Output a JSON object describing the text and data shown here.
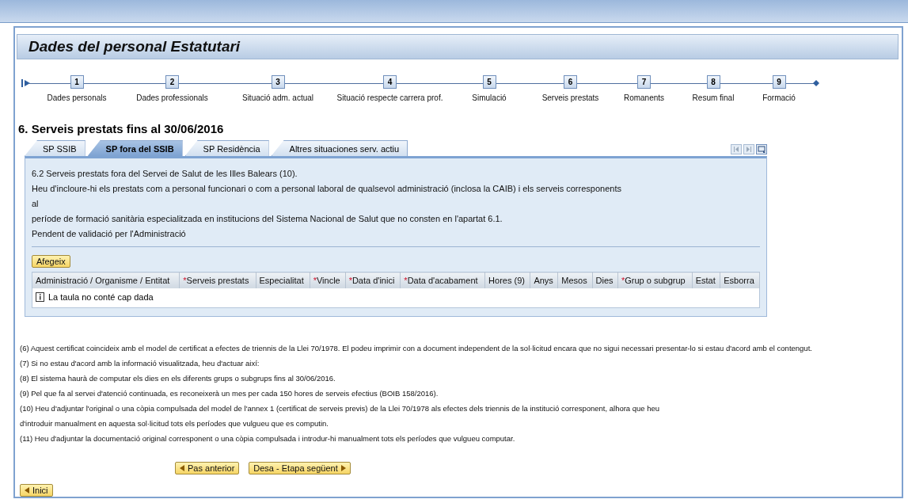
{
  "page_title": "Dades del personal Estatutari",
  "steps": [
    {
      "number": "1",
      "label": "Dades personals"
    },
    {
      "number": "2",
      "label": "Dades professionals"
    },
    {
      "number": "3",
      "label": "Situació adm. actual"
    },
    {
      "number": "4",
      "label": "Situació respecte carrera prof."
    },
    {
      "number": "5",
      "label": "Simulació"
    },
    {
      "number": "6",
      "label": "Serveis prestats"
    },
    {
      "number": "7",
      "label": "Romanents"
    },
    {
      "number": "8",
      "label": "Resum final"
    },
    {
      "number": "9",
      "label": "Formació"
    }
  ],
  "section_title": "6. Serveis prestats fins al 30/06/2016",
  "tabs": [
    {
      "label": "SP SSIB",
      "selected": false
    },
    {
      "label": "SP fora del SSIB",
      "selected": true
    },
    {
      "label": "SP Residència",
      "selected": false
    },
    {
      "label": "Altres situaciones serv. actiu",
      "selected": false
    }
  ],
  "panel": {
    "lines": [
      "6.2 Serveis prestats fora del Servei de Salut de les Illes Balears (10).",
      "Heu d'incloure-hi els prestats com a personal funcionari o com a personal laboral de qualsevol administració (inclosa la CAIB) i els serveis corresponents",
      "al",
      "període de formació sanitària especialitzada en institucions del Sistema Nacional de Salut que no consten en l'apartat 6.1.",
      "Pendent de validació per l'Administració"
    ],
    "add_button": "Afegeix",
    "columns": [
      {
        "label": "Administració / Organisme / Entitat",
        "required": false
      },
      {
        "label": "Serveis prestats",
        "required": true
      },
      {
        "label": "Especialitat",
        "required": false
      },
      {
        "label": "Vincle",
        "required": true
      },
      {
        "label": "Data d'inici",
        "required": true
      },
      {
        "label": "Data d'acabament",
        "required": true
      },
      {
        "label": "Hores (9)",
        "required": false
      },
      {
        "label": "Anys",
        "required": false
      },
      {
        "label": "Mesos",
        "required": false
      },
      {
        "label": "Dies",
        "required": false
      },
      {
        "label": "Grup o subgrup",
        "required": true
      },
      {
        "label": "Estat",
        "required": false
      },
      {
        "label": "Esborra",
        "required": false
      }
    ],
    "required_mark": "*",
    "empty_message": "La taula no conté cap dada"
  },
  "footnotes": [
    "(6) Aquest certificat coincideix amb el model de certificat a efectes de triennis de la Llei 70/1978. El podeu imprimir con a document independent de la sol·licitud encara que no sigui necessari presentar-lo si estau d'acord amb el contengut.",
    "(7) Si no estau d'acord amb la informació visualitzada, heu d'actuar així:",
    "(8) El sistema haurà de computar els dies en els diferents grups o subgrups fins al 30/06/2016.",
    "(9) Pel que fa al servei d'atenció continuada, es reconeixerà un mes per cada 150 hores de serveis efectius (BOIB 158/2016).",
    "(10) Heu d'adjuntar l'original o una còpia compulsada del model de l'annex 1 (certificat de serveis previs) de la Llei 70/1978 als efectes dels triennis de la institució corresponent, alhora que heu",
    "d'introduir manualment en aquesta sol·licitud tots els períodes que vulgueu que es computin.",
    "(11) Heu d'adjuntar la documentació original corresponent o una còpia compulsada i introdur-hi manualment tots els períodes que vulgueu computar."
  ],
  "nav_buttons": [
    {
      "label": "Pas anterior",
      "kind": "back"
    },
    {
      "label": "Desa - Etapa següent",
      "kind": "next"
    }
  ],
  "home_button": {
    "label": "Inici",
    "kind": "back"
  }
}
